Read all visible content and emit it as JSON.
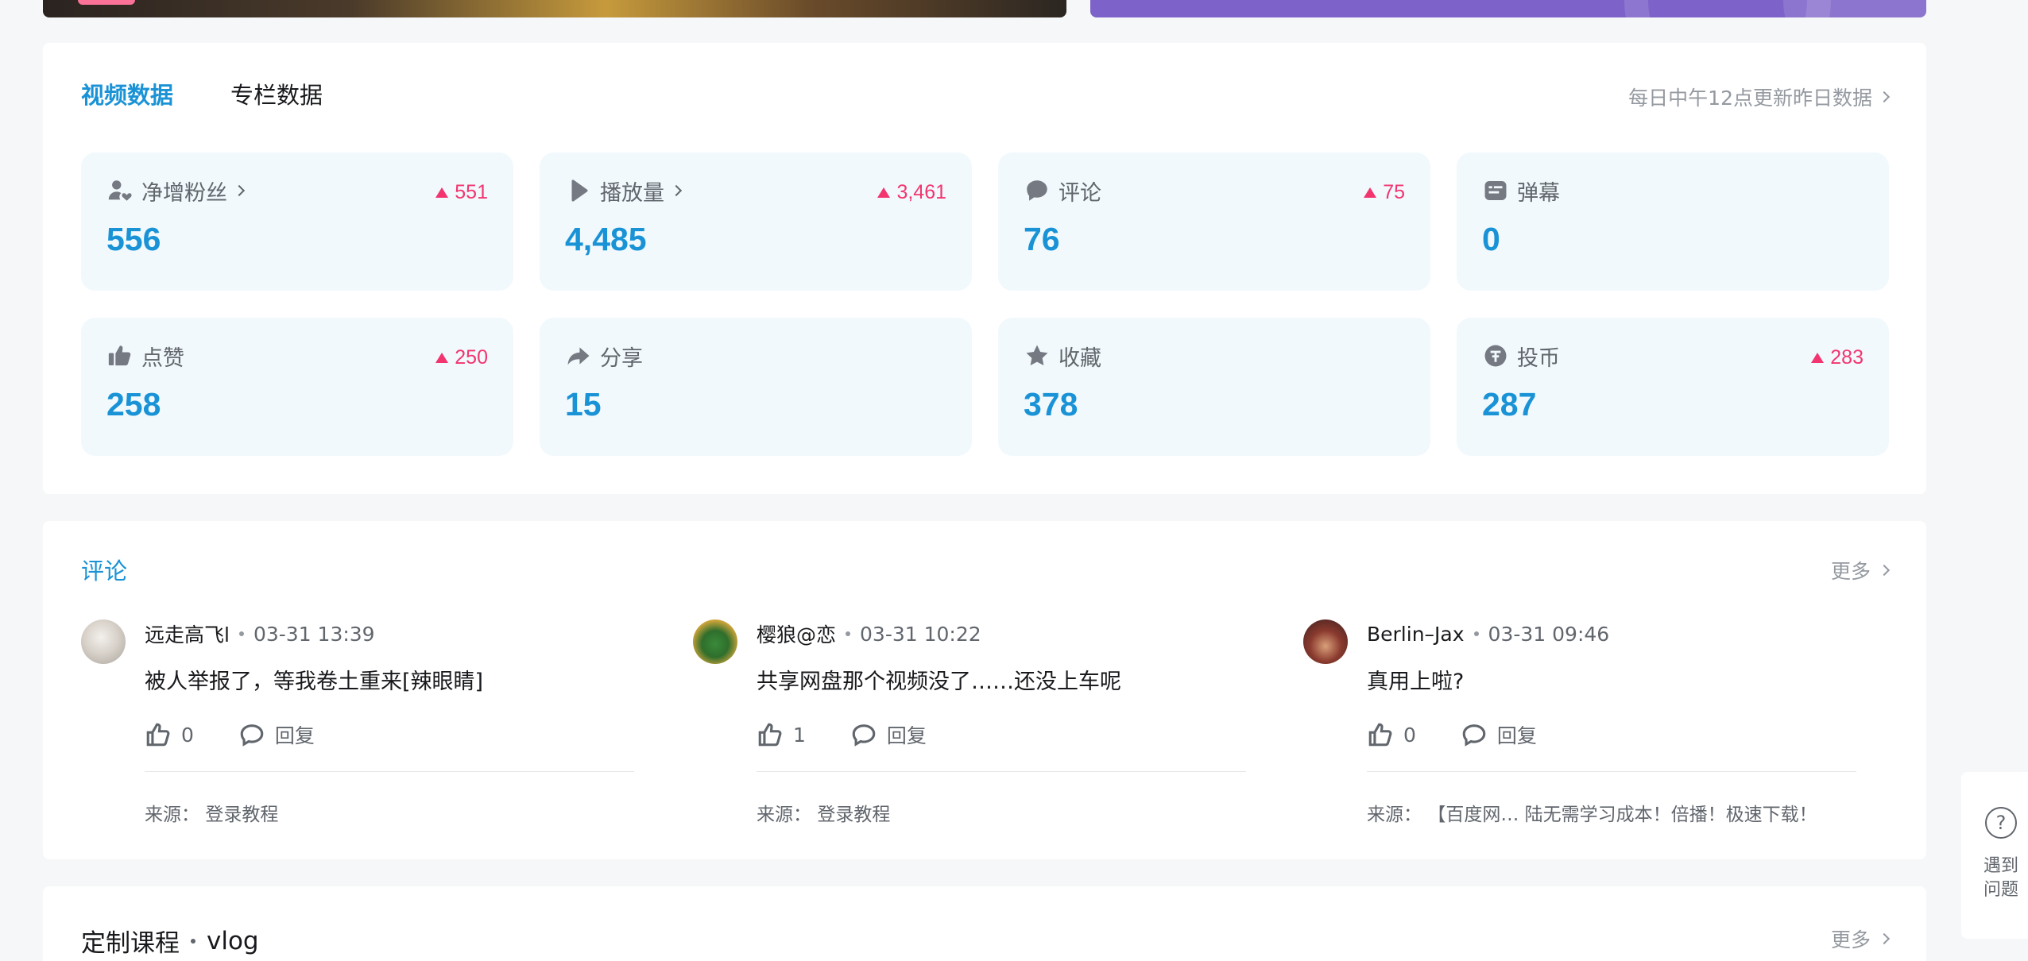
{
  "tabs": [
    {
      "label": "视频数据",
      "active": true
    },
    {
      "label": "专栏数据",
      "active": false
    }
  ],
  "update_note": "每日中午12点更新昨日数据",
  "stats": [
    {
      "icon": "fans-icon",
      "label": "净增粉丝",
      "value": "556",
      "delta": "551",
      "has_link": true
    },
    {
      "icon": "play-icon",
      "label": "播放量",
      "value": "4,485",
      "delta": "3,461",
      "has_link": true
    },
    {
      "icon": "comment-bubble-icon",
      "label": "评论",
      "value": "76",
      "delta": "75",
      "has_link": false
    },
    {
      "icon": "danmaku-icon",
      "label": "弹幕",
      "value": "0",
      "delta": "",
      "has_link": false
    },
    {
      "icon": "thumbs-up-icon",
      "label": "点赞",
      "value": "258",
      "delta": "250",
      "has_link": false
    },
    {
      "icon": "share-icon",
      "label": "分享",
      "value": "15",
      "delta": "",
      "has_link": false
    },
    {
      "icon": "star-icon",
      "label": "收藏",
      "value": "378",
      "delta": "",
      "has_link": false
    },
    {
      "icon": "coin-icon",
      "label": "投币",
      "value": "287",
      "delta": "283",
      "has_link": false
    }
  ],
  "comments_section": {
    "title": "评论",
    "more": "更多",
    "items": [
      {
        "user": "远走高飞l",
        "time": "03-31 13:39",
        "text": "被人举报了，等我卷土重来[辣眼睛]",
        "likes": "0",
        "reply": "回复",
        "source_label": "来源：",
        "source": "登录教程"
      },
      {
        "user": "樱狼@恋",
        "time": "03-31 10:22",
        "text": "共享网盘那个视频没了……还没上车呢",
        "likes": "1",
        "reply": "回复",
        "source_label": "来源：",
        "source": "登录教程"
      },
      {
        "user": "Berlin–Jax",
        "time": "03-31 09:46",
        "text": "真用上啦?",
        "likes": "0",
        "reply": "回复",
        "source_label": "来源：",
        "source": "【百度网… 陆无需学习成本！倍播！极速下载！"
      }
    ]
  },
  "course_section": {
    "title": "定制课程",
    "subtitle": "vlog",
    "more": "更多"
  },
  "help": {
    "label": "遇到问题"
  },
  "colors": {
    "accent": "#1a93d6",
    "increase": "#f2356f",
    "card_bg": "#f1f9fd"
  }
}
